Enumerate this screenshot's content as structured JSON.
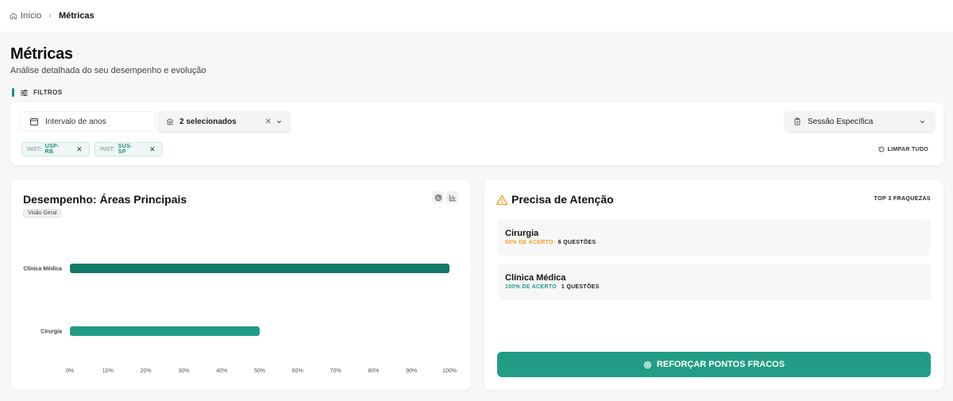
{
  "breadcrumb": {
    "home": "Início",
    "current": "Métricas"
  },
  "page": {
    "title": "Métricas",
    "subtitle": "Análise detalhada do seu desempenho e evolução"
  },
  "filters": {
    "label": "FILTROS",
    "year_range": "Intervalo de anos",
    "institutions": "2 selecionados",
    "session": "Sessão Específica",
    "chips": [
      {
        "prefix": "INST:",
        "value": "USP-RB"
      },
      {
        "prefix": "INST:",
        "value": "SUS-SP"
      }
    ],
    "clear_all": "LIMPAR TUDO"
  },
  "performance": {
    "title": "Desempenho: Áreas Principais",
    "badge": "Visão Geral"
  },
  "chart_data": {
    "type": "bar",
    "orientation": "horizontal",
    "categories": [
      "Clínica Médica",
      "Cirurgia"
    ],
    "values": [
      100,
      50
    ],
    "xlim": [
      0,
      100
    ],
    "x_ticks": [
      "0%",
      "10%",
      "20%",
      "30%",
      "40%",
      "50%",
      "60%",
      "70%",
      "80%",
      "90%",
      "100%"
    ],
    "colors": [
      "#157a68",
      "#229c86"
    ],
    "grid": false
  },
  "attention": {
    "title": "Precisa de Atenção",
    "top_label": "TOP 3 FRAQUEZAS",
    "items": [
      {
        "name": "Cirurgia",
        "accuracy": "50% DE ACERTO",
        "questions": "6 QUESTÕES",
        "accuracy_color": "#f0a020"
      },
      {
        "name": "Clínica Médica",
        "accuracy": "100% DE ACERTO",
        "questions": "1 QUESTÕES",
        "accuracy_color": "#1e9c84"
      }
    ],
    "button": "REFORÇAR PONTOS FRACOS"
  },
  "colors": {
    "accent": "#229c86",
    "warning": "#f0a020"
  }
}
